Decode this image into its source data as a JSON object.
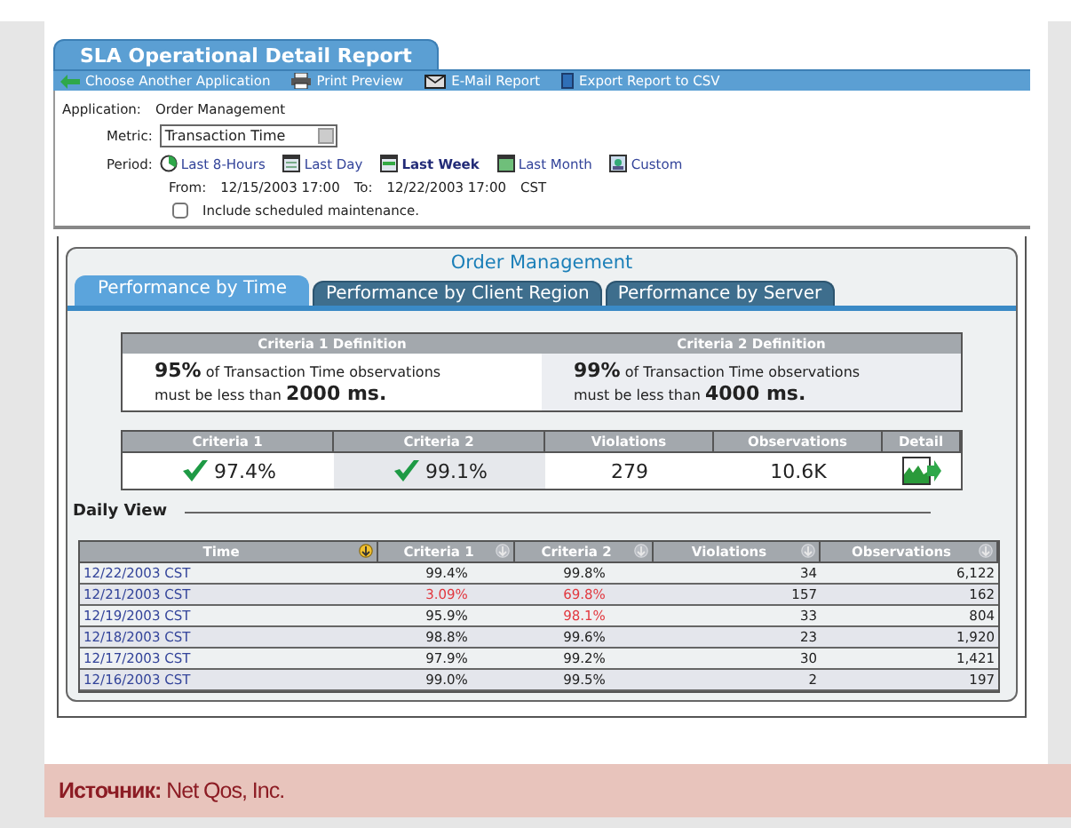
{
  "report_title": "SLA Operational Detail Report",
  "toolbar": [
    {
      "kind": "back",
      "label": "Choose Another Application"
    },
    {
      "kind": "print",
      "label": "Print Preview"
    },
    {
      "kind": "email",
      "label": "E-Mail Report"
    },
    {
      "kind": "export",
      "label": "Export Report to CSV"
    }
  ],
  "application": {
    "label": "Application:",
    "value": "Order Management"
  },
  "metric": {
    "label": "Metric:",
    "value": "Transaction Time"
  },
  "period": {
    "label": "Period:",
    "options": [
      {
        "kind": "clock",
        "label": "Last 8-Hours",
        "selected": false
      },
      {
        "kind": "day",
        "label": "Last Day",
        "selected": false
      },
      {
        "kind": "week",
        "label": "Last Week",
        "selected": true
      },
      {
        "kind": "month",
        "label": "Last Month",
        "selected": false
      },
      {
        "kind": "custom",
        "label": "Custom",
        "selected": false
      }
    ]
  },
  "range": {
    "from_label": "From:",
    "from": "12/15/2003 17:00",
    "to_label": "To:",
    "to": "12/22/2003 17:00",
    "zone": "CST"
  },
  "maintenance": {
    "label": "Include scheduled maintenance.",
    "checked": false
  },
  "panel_title": "Order Management",
  "tabs": [
    {
      "label": "Performance by Time",
      "selected": true
    },
    {
      "label": "Performance by Client Region",
      "selected": false
    },
    {
      "label": "Performance by Server",
      "selected": false
    }
  ],
  "definitions": [
    {
      "heading": "Criteria 1 Definition",
      "percent": "95%",
      "text_1": "of Transaction Time observations",
      "text_2": "must be less than",
      "threshold": "2000 ms."
    },
    {
      "heading": "Criteria 2 Definition",
      "percent": "99%",
      "text_1": "of Transaction Time observations",
      "text_2": "must be less than",
      "threshold": "4000 ms."
    }
  ],
  "summary": {
    "columns": [
      "Criteria 1",
      "Criteria 2",
      "Violations",
      "Observations",
      "Detail"
    ],
    "criteria_1": {
      "value": "97.4%",
      "met": true
    },
    "criteria_2": {
      "value": "99.1%",
      "met": true
    },
    "violations": "279",
    "observations": "10.6K"
  },
  "daily_view": {
    "title": "Daily View",
    "columns": [
      {
        "label": "Time",
        "sorted": true
      },
      {
        "label": "Criteria 1",
        "sorted": false
      },
      {
        "label": "Criteria 2",
        "sorted": false
      },
      {
        "label": "Violations",
        "sorted": false
      },
      {
        "label": "Observations",
        "sorted": false
      }
    ],
    "rows": [
      {
        "time": "12/22/2003 CST",
        "criteria_1": "99.4%",
        "criteria_1_missed": false,
        "criteria_2": "99.8%",
        "criteria_2_missed": false,
        "violations": "34",
        "observations": "6,122"
      },
      {
        "time": "12/21/2003 CST",
        "criteria_1": "3.09%",
        "criteria_1_missed": true,
        "criteria_2": "69.8%",
        "criteria_2_missed": true,
        "violations": "157",
        "observations": "162"
      },
      {
        "time": "12/19/2003 CST",
        "criteria_1": "95.9%",
        "criteria_1_missed": false,
        "criteria_2": "98.1%",
        "criteria_2_missed": true,
        "violations": "33",
        "observations": "804"
      },
      {
        "time": "12/18/2003 CST",
        "criteria_1": "98.8%",
        "criteria_1_missed": false,
        "criteria_2": "99.6%",
        "criteria_2_missed": false,
        "violations": "23",
        "observations": "1,920"
      },
      {
        "time": "12/17/2003 CST",
        "criteria_1": "97.9%",
        "criteria_1_missed": false,
        "criteria_2": "99.2%",
        "criteria_2_missed": false,
        "violations": "30",
        "observations": "1,421"
      },
      {
        "time": "12/16/2003 CST",
        "criteria_1": "99.0%",
        "criteria_1_missed": false,
        "criteria_2": "99.5%",
        "criteria_2_missed": false,
        "violations": "2",
        "observations": "197"
      }
    ]
  },
  "source": "**Источник:** Net Qos, Inc."
}
